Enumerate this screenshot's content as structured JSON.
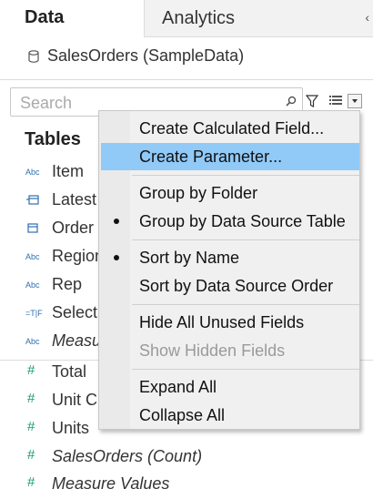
{
  "tabs": {
    "data": "Data",
    "analytics": "Analytics",
    "collapse": "‹"
  },
  "datasource": {
    "name": "SalesOrders (SampleData)"
  },
  "search": {
    "placeholder": "Search"
  },
  "tables_heading": "Tables",
  "fields": [
    {
      "name": "Item",
      "type": "Abc",
      "italic": false
    },
    {
      "name": "Latest",
      "type": "datetime",
      "italic": false
    },
    {
      "name": "Order",
      "type": "date",
      "italic": false
    },
    {
      "name": "Region",
      "type": "Abc",
      "italic": false
    },
    {
      "name": "Rep",
      "type": "Abc",
      "italic": false
    },
    {
      "name": "Select",
      "type": "T|F",
      "italic": false
    },
    {
      "name": "Measure",
      "type": "Abc",
      "italic": true
    }
  ],
  "measures": [
    {
      "name": "Total",
      "type": "#",
      "italic": false
    },
    {
      "name": "Unit C",
      "type": "#",
      "italic": false
    },
    {
      "name": "Units",
      "type": "#",
      "italic": false
    },
    {
      "name": "SalesOrders (Count)",
      "type": "#",
      "italic": true
    },
    {
      "name": "Measure Values",
      "type": "#",
      "italic": true
    }
  ],
  "menu": {
    "items": [
      {
        "label": "Create Calculated Field...",
        "checked": false,
        "disabled": false,
        "highlighted": false
      },
      {
        "label": "Create Parameter...",
        "checked": false,
        "disabled": false,
        "highlighted": true
      },
      {
        "label": "Group by Folder",
        "checked": false,
        "disabled": false,
        "highlighted": false
      },
      {
        "label": "Group by Data Source Table",
        "checked": true,
        "disabled": false,
        "highlighted": false
      },
      {
        "label": "Sort by Name",
        "checked": true,
        "disabled": false,
        "highlighted": false
      },
      {
        "label": "Sort by Data Source Order",
        "checked": false,
        "disabled": false,
        "highlighted": false
      },
      {
        "label": "Hide All Unused Fields",
        "checked": false,
        "disabled": false,
        "highlighted": false
      },
      {
        "label": "Show Hidden Fields",
        "checked": false,
        "disabled": true,
        "highlighted": false
      },
      {
        "label": "Expand All",
        "checked": false,
        "disabled": false,
        "highlighted": false
      },
      {
        "label": "Collapse All",
        "checked": false,
        "disabled": false,
        "highlighted": false
      }
    ]
  },
  "colors": {
    "highlight": "#91c9f7",
    "dimension": "#2e6fb0",
    "measure": "#1a9a77"
  }
}
